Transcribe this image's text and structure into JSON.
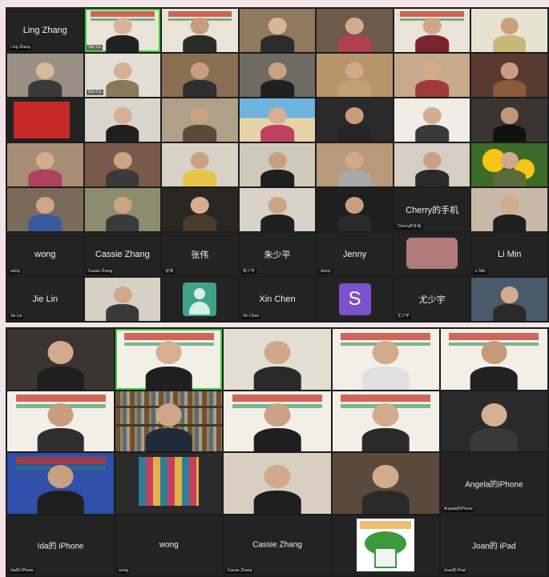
{
  "top_gallery": {
    "tiles": [
      {
        "type": "name",
        "name": "Ling Zhang",
        "label": "Ling Zhang"
      },
      {
        "type": "banner",
        "label": "Yan Liu",
        "speaking": true,
        "bg": "#e9e3d8",
        "skin": "#d7b49a",
        "shirt": "#222222"
      },
      {
        "type": "banner",
        "label": "",
        "bg": "#e9e3d8",
        "skin": "#c59c7e",
        "shirt": "#2b2b2b"
      },
      {
        "type": "video",
        "label": "",
        "bg": "#8f7a5e",
        "skin": "#d8b595",
        "shirt": "#2c2c2c"
      },
      {
        "type": "video",
        "label": "",
        "bg": "#6e5a4a",
        "skin": "#d2ab8e",
        "shirt": "#b04050"
      },
      {
        "type": "banner",
        "label": "",
        "bg": "#e9e3d8",
        "skin": "#d1a58a",
        "shirt": "#7a2430"
      },
      {
        "type": "video",
        "label": "",
        "bg": "#e8e2d2",
        "skin": "#c9a17f",
        "shirt": "#c9b77a"
      },
      {
        "type": "video",
        "label": "",
        "bg": "#9a8f84",
        "skin": "#d8b89e",
        "shirt": "#3a3a3a"
      },
      {
        "type": "video",
        "label": "Dan Du",
        "bg": "#e3dfd6",
        "skin": "#d6b094",
        "shirt": "#8a7a5a"
      },
      {
        "type": "video",
        "label": "",
        "bg": "#8a6e52",
        "skin": "#c79f80",
        "shirt": "#2f2f2f"
      },
      {
        "type": "video",
        "label": "",
        "bg": "#6f6a62",
        "skin": "#caa283",
        "shirt": "#1f1f1f"
      },
      {
        "type": "video",
        "label": "",
        "bg": "#b8946a",
        "skin": "#d1a98a",
        "shirt": "#c2a070"
      },
      {
        "type": "video",
        "label": "",
        "bg": "#c8a98e",
        "skin": "#d3ac8e",
        "shirt": "#a03a3a"
      },
      {
        "type": "video",
        "label": "",
        "bg": "#5a3a30",
        "skin": "#c89d82",
        "shirt": "#8a5a3a"
      },
      {
        "type": "redblock",
        "label": ""
      },
      {
        "type": "video",
        "label": "",
        "bg": "#d9d4cc",
        "skin": "#d5b094",
        "shirt": "#1f1f1f"
      },
      {
        "type": "video",
        "label": "",
        "bg": "#b0a088",
        "skin": "#c9a183",
        "shirt": "#5a4a3a"
      },
      {
        "type": "beach",
        "label": "",
        "skin": "#d6b093",
        "shirt": "#c04060"
      },
      {
        "type": "video",
        "label": "",
        "bg": "#2a2a2a",
        "skin": "#c69c7d",
        "shirt": "#242424"
      },
      {
        "type": "video",
        "label": "",
        "bg": "#f0ece6",
        "skin": "#d3ad90",
        "shirt": "#3a3a3a"
      },
      {
        "type": "video",
        "label": "",
        "bg": "#3a3432",
        "skin": "#c29678",
        "shirt": "#111111"
      },
      {
        "type": "video",
        "label": "",
        "bg": "#a88c74",
        "skin": "#d4ad90",
        "shirt": "#b04060"
      },
      {
        "type": "video",
        "label": "",
        "bg": "#7a5a4a",
        "skin": "#cfa486",
        "shirt": "#3a3a3a"
      },
      {
        "type": "video",
        "label": "",
        "bg": "#d7d1c6",
        "skin": "#caa386",
        "shirt": "#e6c64a"
      },
      {
        "type": "video",
        "label": "",
        "bg": "#cfc9bc",
        "skin": "#c7a083",
        "shirt": "#1f1f1f"
      },
      {
        "type": "video",
        "label": "",
        "bg": "#b89a7a",
        "skin": "#d0a88a",
        "shirt": "#a8a8a8"
      },
      {
        "type": "video",
        "label": "",
        "bg": "#d6cec2",
        "skin": "#caa283",
        "shirt": "#2a2a2a"
      },
      {
        "type": "flowers",
        "label": "",
        "skin": "#d0a98b",
        "shirt": "#5a6a3a"
      },
      {
        "type": "video",
        "label": "",
        "bg": "#7a6a5a",
        "skin": "#cda587",
        "shirt": "#3a5aa0"
      },
      {
        "type": "video",
        "label": "",
        "bg": "#8c8c6e",
        "skin": "#caa284",
        "shirt": "#3a3a3a"
      },
      {
        "type": "video",
        "label": "",
        "bg": "#2a2624",
        "skin": "#d5ad8f",
        "shirt": "#4a3a2a"
      },
      {
        "type": "video",
        "label": "",
        "bg": "#d8d2c8",
        "skin": "#cca486",
        "shirt": "#1f1f1f"
      },
      {
        "type": "video",
        "label": "",
        "bg": "#1f1f1f",
        "skin": "#c99f80",
        "shirt": "#2a2a2a"
      },
      {
        "type": "name",
        "name": "Cherry的手机",
        "label": "Cherry的手机"
      },
      {
        "type": "video",
        "label": "",
        "bg": "#c7b9a6",
        "skin": "#d2aa8c",
        "shirt": "#1f1f1f"
      },
      {
        "type": "name",
        "name": "wong",
        "label": "wong"
      },
      {
        "type": "name",
        "name": "Cassie Zhang",
        "label": "Cassie Zhang"
      },
      {
        "type": "name",
        "name": "张伟",
        "label": "张伟"
      },
      {
        "type": "name",
        "name": "朱少平",
        "label": "朱少平"
      },
      {
        "type": "name",
        "name": "Jenny",
        "label": "Jenny"
      },
      {
        "type": "hand",
        "label": ""
      },
      {
        "type": "name",
        "name": "Li Min",
        "label": "Li Min"
      },
      {
        "type": "name",
        "name": "Jie Lin",
        "label": "Jie Lin"
      },
      {
        "type": "video",
        "label": "",
        "bg": "#d8d0c4",
        "skin": "#d0a88a",
        "shirt": "#3a3a3a"
      },
      {
        "type": "avatar",
        "label": ""
      },
      {
        "type": "name",
        "name": "Xin Chen",
        "label": "Xin Chen"
      },
      {
        "type": "letter",
        "letter": "S",
        "label": ""
      },
      {
        "type": "name",
        "name": "尤少宇",
        "label": "尤少宇"
      },
      {
        "type": "video",
        "label": "",
        "bg": "#4a5a6a",
        "skin": "#d4ab8e",
        "shirt": "#2a2a2a"
      }
    ]
  },
  "bottom_gallery": {
    "tiles": [
      {
        "type": "video",
        "label": "",
        "bg": "#3a3432",
        "skin": "#d2aa8c",
        "shirt": "#1f1f1f"
      },
      {
        "type": "banner",
        "label": "",
        "speaking": true,
        "bg": "#f2efe6",
        "skin": "#d6ae90",
        "shirt": "#1f1f1f"
      },
      {
        "type": "video",
        "label": "",
        "bg": "#e4ddd2",
        "skin": "#d0a889",
        "shirt": "#2a2a2a"
      },
      {
        "type": "banner",
        "label": "",
        "bg": "#f2efe6",
        "skin": "#d2ab8c",
        "shirt": "#e0e0e0"
      },
      {
        "type": "banner",
        "label": "",
        "bg": "#f2efe6",
        "skin": "#c49a7b",
        "shirt": "#222222"
      },
      {
        "type": "banner",
        "label": "",
        "bg": "#f2efe6",
        "skin": "#c79d7e",
        "shirt": "#2f2f2f"
      },
      {
        "type": "bookshelf",
        "label": "",
        "skin": "#cfa687",
        "shirt": "#1f2a3a"
      },
      {
        "type": "banner",
        "label": "",
        "bg": "#f2efe6",
        "skin": "#caa184",
        "shirt": "#1f1f1f"
      },
      {
        "type": "banner",
        "label": "",
        "bg": "#f2efe6",
        "skin": "#d3ab8d",
        "shirt": "#2a2a2a"
      },
      {
        "type": "video",
        "label": "",
        "bg": "#2a2a2a",
        "skin": "#d6ae91",
        "shirt": "#3a3a3a"
      },
      {
        "type": "banner",
        "label": "",
        "bg": "#2f4fa8",
        "skin": "#c99f80",
        "shirt": "#1f1f1f"
      },
      {
        "type": "game",
        "label": ""
      },
      {
        "type": "video",
        "label": "",
        "bg": "#d8cfc2",
        "skin": "#d2aa8b",
        "shirt": "#1f1f1f"
      },
      {
        "type": "video",
        "label": "",
        "bg": "#5a4a3e",
        "skin": "#d3ab8d",
        "shirt": "#2a2a2a"
      },
      {
        "type": "name",
        "name": "Angela的iPhone",
        "label": "Angela的iPhone"
      },
      {
        "type": "name",
        "name": "Ida的 iPhone",
        "label": "Ida的 iPhone"
      },
      {
        "type": "name",
        "name": "wong",
        "label": "wong"
      },
      {
        "type": "name",
        "name": "Cassie Zhang",
        "label": "Cassie Zhang"
      },
      {
        "type": "logo",
        "label": ""
      },
      {
        "type": "name",
        "name": "Joan的 iPad",
        "label": "Joan的 iPad"
      }
    ]
  },
  "colors": {
    "page_bg": "#f2e3e6",
    "panel_bg": "#1c1c1c",
    "tile_bg": "#232323",
    "active_speaker": "#3ad13a",
    "name_text": "#f1f1f1"
  }
}
